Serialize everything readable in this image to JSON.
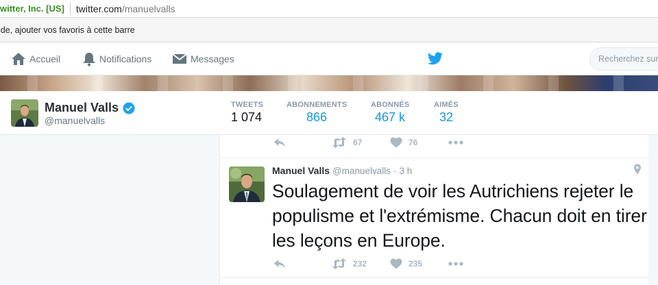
{
  "browser": {
    "cert": "witter, Inc. [US]",
    "url_host": "twitter.com",
    "url_path": "/manuelvalls",
    "bookmarks_text": "ide, ajouter vos favoris à cette barre"
  },
  "nav": {
    "home": "Accueil",
    "notifications": "Notifications",
    "messages": "Messages",
    "search_placeholder": "Recherchez sur Twitter"
  },
  "profile": {
    "name": "Manuel Valls",
    "handle": "@manuelvalls",
    "stats": [
      {
        "label": "TWEETS",
        "value": "1 074"
      },
      {
        "label": "ABONNEMENTS",
        "value": "866"
      },
      {
        "label": "ABONNÉS",
        "value": "467 k"
      },
      {
        "label": "AIMÉS",
        "value": "32"
      }
    ]
  },
  "previous_tweet": {
    "retweets": "67",
    "likes": "76"
  },
  "tweet": {
    "name": "Manuel Valls",
    "handle": "@manuelvalls",
    "dot": "·",
    "time": "3 h",
    "text": "Soulagement de voir les Autrichiens rejeter le populisme et l'extrémisme. Chacun doit en tirer les leçons en Europe.",
    "retweets": "232",
    "likes": "235"
  },
  "colors": {
    "accent": "#1b95e0",
    "twitter_blue": "#1da1f2",
    "verified": "#1da1f2",
    "cert_green": "#3c8f26"
  },
  "icons": [
    "home-icon",
    "bell-icon",
    "envelope-icon",
    "twitter-bird-icon",
    "verified-icon",
    "reply-icon",
    "retweet-icon",
    "heart-icon",
    "more-icon",
    "location-pin-icon"
  ]
}
